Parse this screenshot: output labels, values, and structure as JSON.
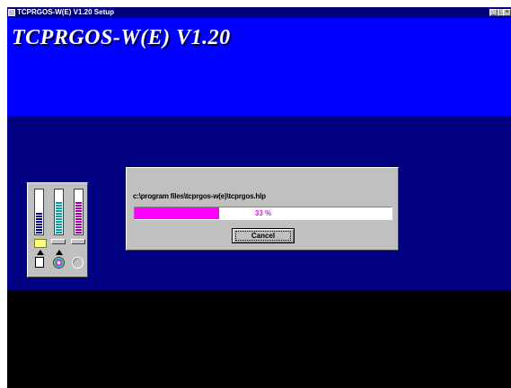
{
  "window": {
    "title": "TCPRGOS-W(E) V1.20 Setup",
    "buttons": [
      "_",
      "□",
      "×"
    ]
  },
  "banner": {
    "title": "TCPRGOS-W(E) V1.20"
  },
  "progress_dialog": {
    "current_file": "c:\\program files\\tcprgos-w(e)\\tcprgos.hlp",
    "progress_percent": 33,
    "progress_label": "33 %",
    "cancel_label": "Cancel"
  },
  "disk_meters": {
    "meters": [
      {
        "name": "meter-1",
        "color": "#00007b"
      },
      {
        "name": "meter-2",
        "color": "#00a0a0"
      },
      {
        "name": "meter-3",
        "color": "#a000a0"
      }
    ],
    "icons": [
      "folder-icon",
      "floppy-icon",
      "cd-icon",
      "disc-icon"
    ]
  },
  "colors": {
    "title_bar": "#00007b",
    "banner": "#0000ff",
    "mid_band": "#000080",
    "progress_fill": "#ff00ff"
  }
}
